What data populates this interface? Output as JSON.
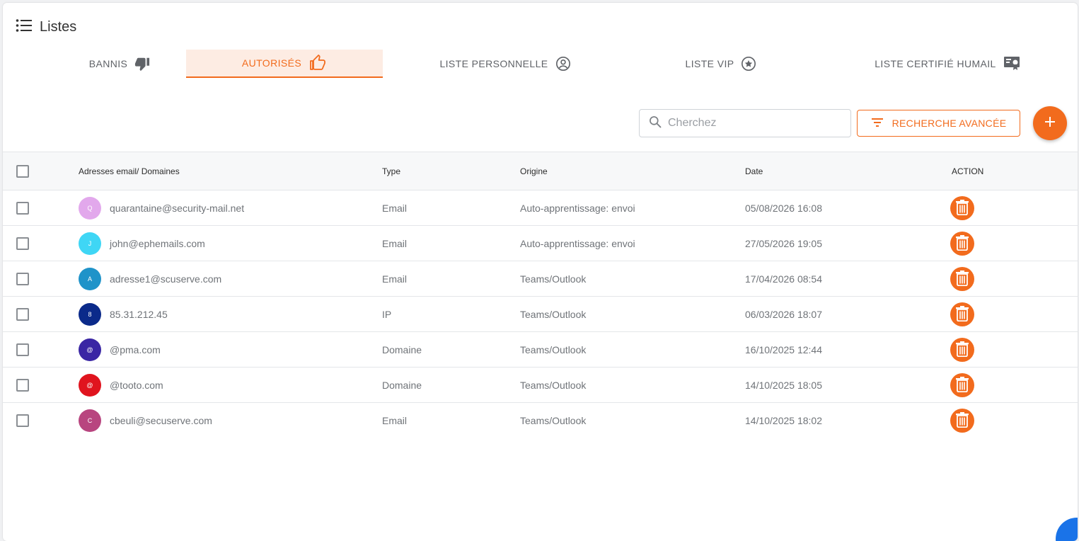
{
  "page": {
    "title": "Listes"
  },
  "tabs": [
    {
      "label": "BANNIS",
      "icon": "thumbs-down-icon"
    },
    {
      "label": "AUTORISÉS",
      "icon": "thumbs-up-icon",
      "active": true
    },
    {
      "label": "LISTE PERSONNELLE",
      "icon": "user-circle-icon"
    },
    {
      "label": "LISTE VIP",
      "icon": "star-circle-icon"
    },
    {
      "label": "LISTE CERTIFIÉ HUMAIL",
      "icon": "certificate-icon"
    }
  ],
  "search": {
    "placeholder": "Cherchez",
    "value": ""
  },
  "advanced_search": {
    "label": "RECHERCHE AVANCÉE"
  },
  "table": {
    "headers": {
      "address": "Adresses email/ Domaines",
      "type": "Type",
      "origin": "Origine",
      "date": "Date",
      "action": "ACTION"
    },
    "rows": [
      {
        "initial": "Q",
        "avatar_color": "#e2a8ec",
        "address": "quarantaine@security-mail.net",
        "type": "Email",
        "origin": "Auto-apprentissage: envoi",
        "date": "05/08/2026 16:08"
      },
      {
        "initial": "J",
        "avatar_color": "#3fd6f5",
        "address": "john@ephemails.com",
        "type": "Email",
        "origin": "Auto-apprentissage: envoi",
        "date": "27/05/2026 19:05"
      },
      {
        "initial": "A",
        "avatar_color": "#1f93c9",
        "address": "adresse1@scuserve.com",
        "type": "Email",
        "origin": "Teams/Outlook",
        "date": "17/04/2026 08:54"
      },
      {
        "initial": "8",
        "avatar_color": "#0b2a8a",
        "address": "85.31.212.45",
        "type": "IP",
        "origin": "Teams/Outlook",
        "date": "06/03/2026 18:07"
      },
      {
        "initial": "@",
        "avatar_color": "#3a26a4",
        "address": "@pma.com",
        "type": "Domaine",
        "origin": "Teams/Outlook",
        "date": "16/10/2025 12:44"
      },
      {
        "initial": "@",
        "avatar_color": "#e0141e",
        "address": "@tooto.com",
        "type": "Domaine",
        "origin": "Teams/Outlook",
        "date": "14/10/2025 18:05"
      },
      {
        "initial": "C",
        "avatar_color": "#b8457f",
        "address": "cbeuli@secuserve.com",
        "type": "Email",
        "origin": "Teams/Outlook",
        "date": "14/10/2025 18:02"
      }
    ]
  },
  "colors": {
    "accent": "#f26b1d",
    "accent_light": "#fdece3"
  }
}
